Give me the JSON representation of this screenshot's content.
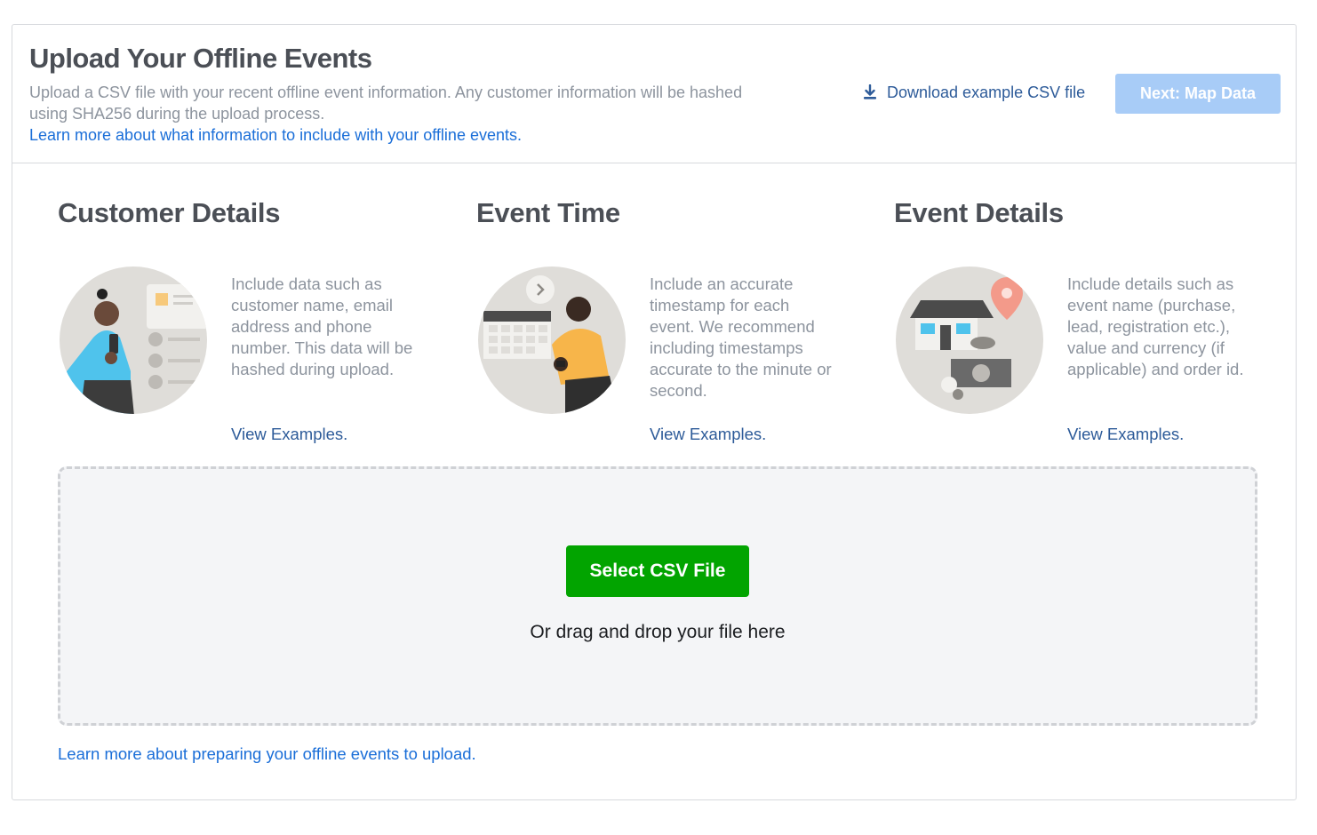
{
  "header": {
    "title": "Upload Your Offline Events",
    "description": "Upload a CSV file with your recent offline event information. Any customer information will be hashed using SHA256 during the upload process.",
    "learn_more_link": "Learn more about what information to include with your offline events.",
    "download_link": "Download example CSV file",
    "download_icon": "download-icon",
    "next_button": "Next: Map Data"
  },
  "columns": [
    {
      "title": "Customer Details",
      "description": "Include data such as customer name, email address and phone number. This data will be hashed during upload.",
      "link": "View Examples."
    },
    {
      "title": "Event Time",
      "description": "Include an accurate timestamp for each event. We recommend including timestamps accurate to the minute or second.",
      "link": "View Examples."
    },
    {
      "title": "Event Details",
      "description": "Include details such as event name (purchase, lead, registration etc.), value and currency (if applicable) and order id.",
      "link": "View Examples."
    }
  ],
  "dropzone": {
    "button": "Select CSV File",
    "text": "Or drag and drop your file here"
  },
  "footer": {
    "learn_more_link": "Learn more about preparing your offline events to upload."
  },
  "colors": {
    "primary_link": "#1a6ed8",
    "secondary_link": "#2d5b99",
    "select_button": "#02a400",
    "next_button_disabled": "#a8ccf7"
  }
}
